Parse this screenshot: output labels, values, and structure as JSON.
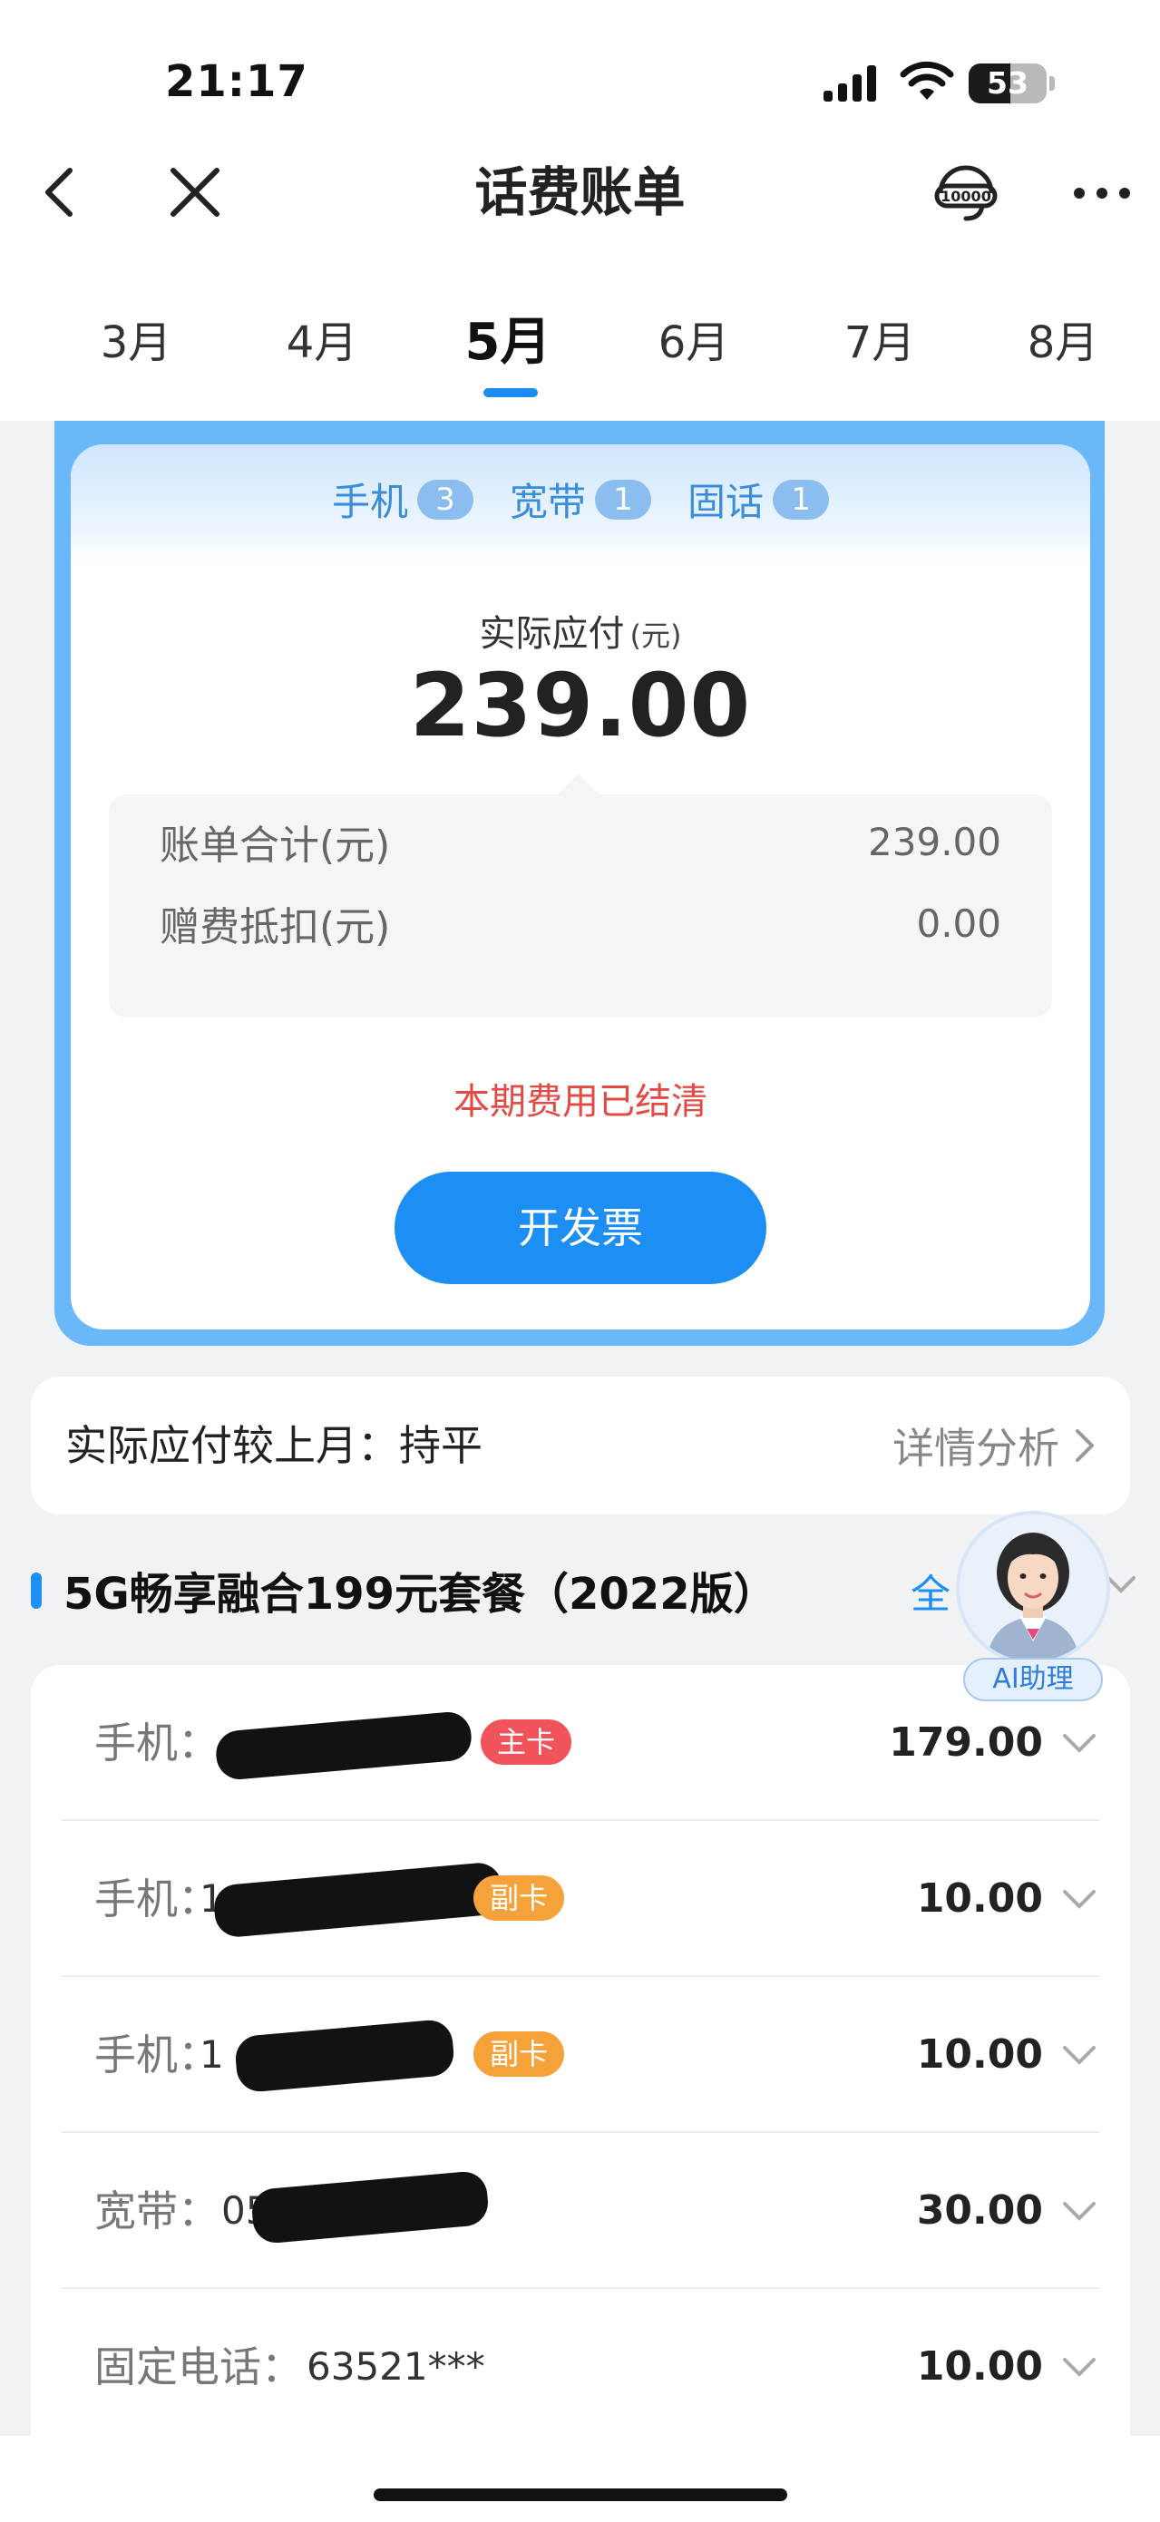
{
  "status_bar": {
    "time": "21:17",
    "battery": "53",
    "battery_level": 0.53
  },
  "nav": {
    "title": "话费账单",
    "back_icon": "chevron-left-icon",
    "close_icon": "close-icon",
    "service_icon": "10000-headset-icon",
    "more_icon": "more-dots-icon"
  },
  "months": {
    "items": [
      "3月",
      "4月",
      "5月",
      "6月",
      "7月",
      "8月"
    ],
    "active": "5月"
  },
  "bill": {
    "chips": [
      {
        "label": "手机",
        "count": "3"
      },
      {
        "label": "宽带",
        "count": "1"
      },
      {
        "label": "固话",
        "count": "1"
      }
    ],
    "pay_label": "实际应付",
    "pay_unit": "(元)",
    "pay_amount": "239.00",
    "summary": [
      {
        "label": "账单合计(元)",
        "value": "239.00"
      },
      {
        "label": "赠费抵扣(元)",
        "value": "0.00"
      }
    ],
    "status": "本期费用已结清",
    "invoice_button": "开发票"
  },
  "compare": {
    "label": "实际应付较上月：持平",
    "link": "详情分析"
  },
  "package": {
    "title": "5G畅享融合199元套餐（2022版）",
    "more": "全"
  },
  "assistant": {
    "label": "AI助理"
  },
  "lines": [
    {
      "label": "手机：",
      "number": "",
      "badge": "主卡",
      "badge_type": "main",
      "amount": "179.00"
    },
    {
      "label": "手机：",
      "number": "1",
      "badge": "副卡",
      "badge_type": "sub",
      "amount": "10.00"
    },
    {
      "label": "手机：",
      "number": "1",
      "badge": "副卡",
      "badge_type": "sub",
      "amount": "10.00"
    },
    {
      "label": "宽带：",
      "number": "05124",
      "badge": "",
      "badge_type": "",
      "amount": "30.00"
    },
    {
      "label": "固定电话：",
      "number": "63521***",
      "badge": "",
      "badge_type": "",
      "amount": "10.00"
    }
  ],
  "colors": {
    "accent": "#1d8ef4",
    "card_blue": "#6ab8fa",
    "settled_red": "#e24b45",
    "badge_main": "#f0535a",
    "badge_sub": "#f6a23a"
  }
}
